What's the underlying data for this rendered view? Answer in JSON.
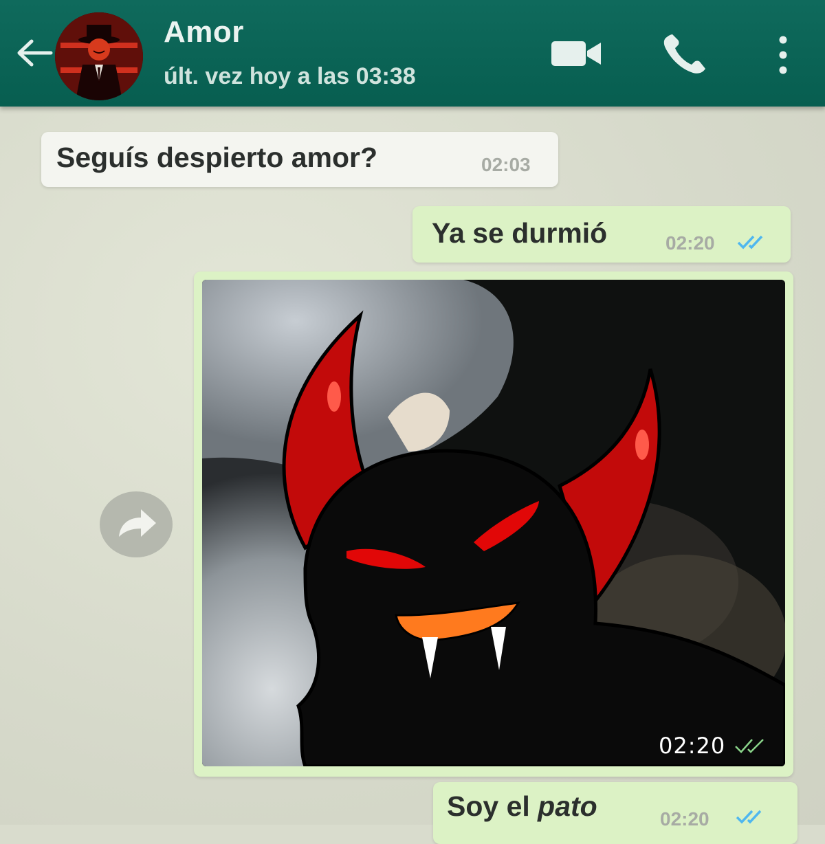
{
  "header": {
    "contact_name": "Amor",
    "last_seen": "últ. vez hoy a las 03:38",
    "icons": [
      "back-arrow-icon",
      "video-call-icon",
      "phone-icon",
      "more-options-icon"
    ]
  },
  "messages": [
    {
      "direction": "incoming",
      "text": "Seguís despierto amor?",
      "time": "02:03"
    },
    {
      "direction": "outgoing",
      "text": "Ya se durmió",
      "time": "02:20",
      "status": "read"
    },
    {
      "direction": "outgoing",
      "type": "image",
      "time": "02:20",
      "status": "delivered"
    },
    {
      "direction": "outgoing",
      "text_plain": "Soy el ",
      "text_emphasis": "pato",
      "time": "02:20",
      "status": "read"
    }
  ],
  "colors": {
    "header": "#075e50",
    "incoming_bubble": "#f4f5f0",
    "outgoing_bubble": "#dcf2c5",
    "read_ticks": "#4fb7ef"
  }
}
